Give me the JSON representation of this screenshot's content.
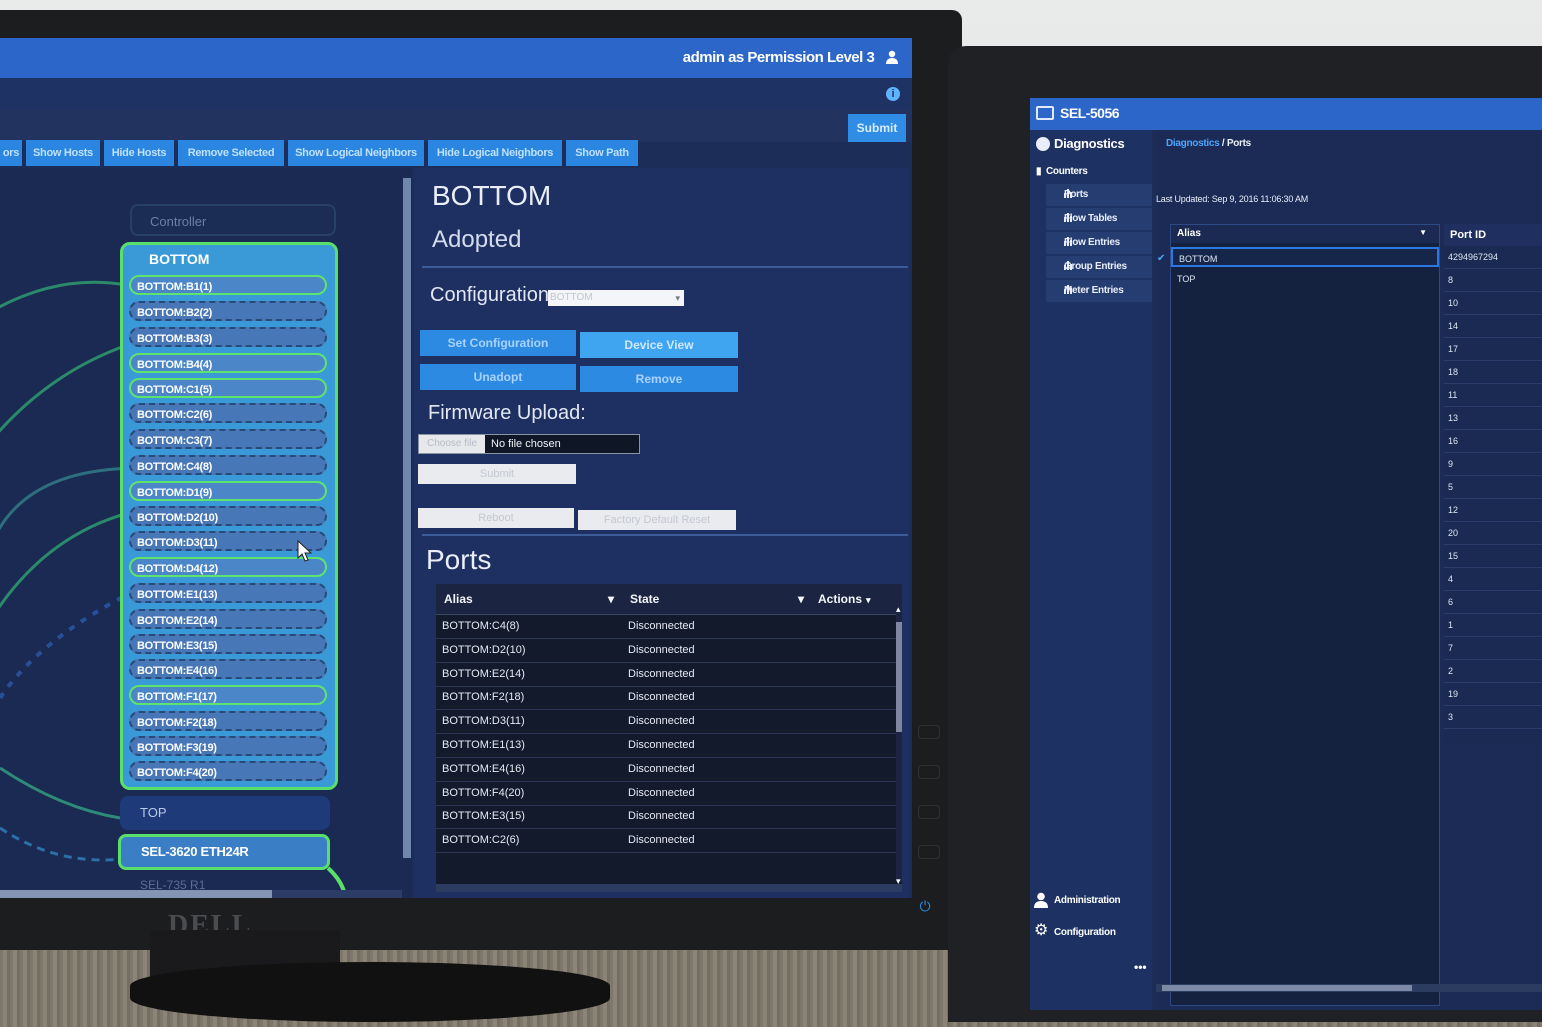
{
  "left_app": {
    "user_label": "admin as Permission Level 3",
    "submit_label": "Submit",
    "toolbar": [
      {
        "label": "ors"
      },
      {
        "label": "Show Hosts"
      },
      {
        "label": "Hide Hosts"
      },
      {
        "label": "Remove Selected"
      },
      {
        "label": "Show Logical Neighbors"
      },
      {
        "label": "Hide Logical Neighbors"
      },
      {
        "label": "Show Path"
      }
    ],
    "graph": {
      "controller_label": "Controller",
      "group_title": "BOTTOM",
      "ports": [
        {
          "label": "BOTTOM:B1(1)",
          "highlighted": true
        },
        {
          "label": "BOTTOM:B2(2)",
          "highlighted": false
        },
        {
          "label": "BOTTOM:B3(3)",
          "highlighted": false
        },
        {
          "label": "BOTTOM:B4(4)",
          "highlighted": true
        },
        {
          "label": "BOTTOM:C1(5)",
          "highlighted": true
        },
        {
          "label": "BOTTOM:C2(6)",
          "highlighted": false
        },
        {
          "label": "BOTTOM:C3(7)",
          "highlighted": false
        },
        {
          "label": "BOTTOM:C4(8)",
          "highlighted": false
        },
        {
          "label": "BOTTOM:D1(9)",
          "highlighted": true
        },
        {
          "label": "BOTTOM:D2(10)",
          "highlighted": false
        },
        {
          "label": "BOTTOM:D3(11)",
          "highlighted": false
        },
        {
          "label": "BOTTOM:D4(12)",
          "highlighted": true
        },
        {
          "label": "BOTTOM:E1(13)",
          "highlighted": false
        },
        {
          "label": "BOTTOM:E2(14)",
          "highlighted": false
        },
        {
          "label": "BOTTOM:E3(15)",
          "highlighted": false
        },
        {
          "label": "BOTTOM:E4(16)",
          "highlighted": false
        },
        {
          "label": "BOTTOM:F1(17)",
          "highlighted": true
        },
        {
          "label": "BOTTOM:F2(18)",
          "highlighted": false
        },
        {
          "label": "BOTTOM:F3(19)",
          "highlighted": false
        },
        {
          "label": "BOTTOM:F4(20)",
          "highlighted": false
        }
      ],
      "top_node_label": "TOP",
      "switch_node_label": "SEL-3620 ETH24R",
      "partial_node_label": "SEL-735 R1"
    },
    "panel": {
      "title": "BOTTOM",
      "status": "Adopted",
      "configuration_label": "Configuration:",
      "configuration_value": "BOTTOM",
      "set_configuration_label": "Set Configuration",
      "device_view_label": "Device View",
      "unadopt_label": "Unadopt",
      "remove_label": "Remove",
      "firmware_label": "Firmware Upload:",
      "choose_file_label": "Choose file",
      "no_file_label": "No file chosen",
      "upload_submit_label": "Submit",
      "reboot_label": "Reboot",
      "factory_reset_label": "Factory Default Reset",
      "ports_title": "Ports",
      "columns": {
        "alias": "Alias",
        "state": "State",
        "actions": "Actions"
      },
      "rows": [
        {
          "alias": "BOTTOM:C4(8)",
          "state": "Disconnected"
        },
        {
          "alias": "BOTTOM:D2(10)",
          "state": "Disconnected"
        },
        {
          "alias": "BOTTOM:E2(14)",
          "state": "Disconnected"
        },
        {
          "alias": "BOTTOM:F2(18)",
          "state": "Disconnected"
        },
        {
          "alias": "BOTTOM:D3(11)",
          "state": "Disconnected"
        },
        {
          "alias": "BOTTOM:E1(13)",
          "state": "Disconnected"
        },
        {
          "alias": "BOTTOM:E4(16)",
          "state": "Disconnected"
        },
        {
          "alias": "BOTTOM:F4(20)",
          "state": "Disconnected"
        },
        {
          "alias": "BOTTOM:E3(15)",
          "state": "Disconnected"
        },
        {
          "alias": "BOTTOM:C2(6)",
          "state": "Disconnected"
        }
      ]
    },
    "monitor_brand": "DELL"
  },
  "right_app": {
    "title": "SEL-5056",
    "nav": {
      "diagnostics": "Diagnostics",
      "counters": "Counters",
      "items": [
        {
          "label": "Ports"
        },
        {
          "label": "Flow Tables"
        },
        {
          "label": "Flow Entries"
        },
        {
          "label": "Group Entries"
        },
        {
          "label": "Meter Entries"
        }
      ],
      "administration": "Administration",
      "configuration": "Configuration",
      "more": "•••"
    },
    "breadcrumb": {
      "parent": "Diagnostics",
      "separator": "/",
      "current": "Ports"
    },
    "last_updated": "Last Updated: Sep 9, 2016 11:06:30 AM",
    "alias_header": "Alias",
    "alias_rows": [
      {
        "label": "BOTTOM",
        "selected": true
      },
      {
        "label": "TOP",
        "selected": false
      }
    ],
    "port_id_header": "Port ID",
    "port_ids": [
      "4294967294",
      "8",
      "10",
      "14",
      "17",
      "18",
      "11",
      "13",
      "16",
      "9",
      "5",
      "12",
      "20",
      "15",
      "4",
      "6",
      "1",
      "7",
      "2",
      "19",
      "3"
    ]
  },
  "colors": {
    "accent_blue": "#2c66c8",
    "highlight_green": "#58e06a",
    "background_navy": "#1c2d58"
  }
}
